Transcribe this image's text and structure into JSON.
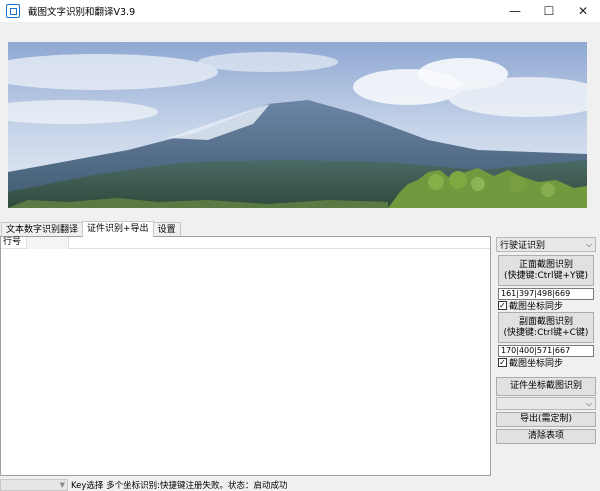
{
  "window": {
    "title": "截图文字识别和翻译V3.9",
    "minimize_glyph": "—",
    "maximize_glyph": "☐",
    "close_glyph": "✕"
  },
  "tabs": [
    {
      "label": "文本数字识别翻译",
      "active": false
    },
    {
      "label": "证件识别+导出",
      "active": true
    },
    {
      "label": "设置",
      "active": false
    }
  ],
  "list": {
    "columns": [
      "行号",
      ""
    ]
  },
  "right_panel": {
    "mode_select": "行驶证识别",
    "front_button_line1": "正面截图识别",
    "front_button_line2": "(快捷键:Ctrl键+Y键)",
    "front_coords": "161|397|498|669",
    "front_sync_label": "截图坐标同步",
    "front_sync_checked": true,
    "back_button_line1": "副面截图识别",
    "back_button_line2": "(快捷键:Ctrl键+C键)",
    "back_coords": "170|400|571|667",
    "back_sync_label": "截图坐标同步",
    "back_sync_checked": true,
    "coord_recognize_button": "证件坐标截图识别",
    "second_select": "",
    "export_button": "导出(需定制)",
    "clear_button": "清除表项"
  },
  "status": {
    "left_select": "",
    "text": "Key选择 多个坐标识别:快捷键注册失败。状态：启动成功"
  },
  "colors": {
    "accent": "#1e70c8",
    "sky_top": "#9db3d6",
    "mountain": "#4a6a8a",
    "trees": "#5f8a3a"
  }
}
